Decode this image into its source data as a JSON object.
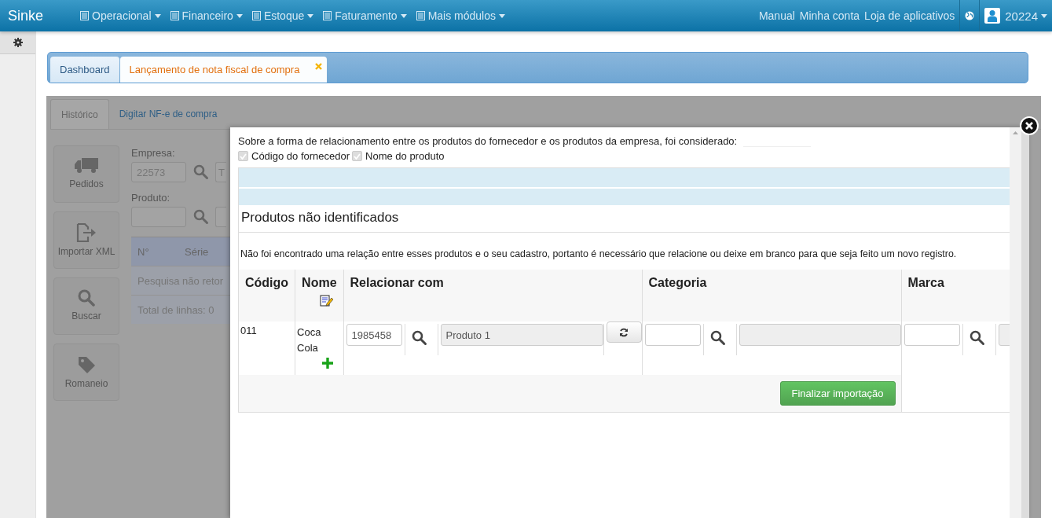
{
  "navbar": {
    "brand": "Sinke",
    "menus": [
      {
        "label": "Operacional"
      },
      {
        "label": "Financeiro"
      },
      {
        "label": "Estoque"
      },
      {
        "label": "Faturamento"
      },
      {
        "label": "Mais módulos"
      }
    ],
    "links": [
      "Manual",
      "Minha conta",
      "Loja de aplicativos"
    ],
    "user": "20224"
  },
  "tabs": [
    {
      "label": "Dashboard",
      "selected": false,
      "closable": false
    },
    {
      "label": "Lançamento de nota fiscal de compra",
      "selected": true,
      "closable": true
    }
  ],
  "page": {
    "subtabs": [
      {
        "label": "Histórico",
        "selected": true
      },
      {
        "label": "Digitar NF-e de compra",
        "selected": false
      }
    ],
    "actions": [
      {
        "label": "Pedidos",
        "kind": "orders"
      },
      {
        "label": "Importar XML",
        "kind": "import"
      },
      {
        "label": "Buscar",
        "kind": "search"
      },
      {
        "label": "Romaneio",
        "kind": "packing"
      }
    ],
    "fields": [
      {
        "label": "Empresa:",
        "value": "22573",
        "extra_value": "T"
      },
      {
        "label": "Produto:"
      }
    ],
    "table": {
      "columns": [
        "N°",
        "Série"
      ],
      "message": "Pesquisa não retor",
      "total": "Total de linhas: 0"
    }
  },
  "modal": {
    "intro": "Sobre a forma de relacionamento entre os produtos do fornecedor e os produtos da empresa, foi considerado:",
    "criteria": [
      {
        "label": "Código do fornecedor",
        "checked": true,
        "disabled": true
      },
      {
        "label": "Nome do produto",
        "checked": true,
        "disabled": true
      }
    ],
    "heading": "Produtos não identificados",
    "note": "Não foi encontrado uma relação entre esses produtos e o seu cadastro, portanto é necessário que relacione ou deixe em branco para que seja feito um novo registro.",
    "table": {
      "columns": [
        {
          "label": "Código",
          "kind": "text"
        },
        {
          "label": "Nome",
          "kind": "name"
        },
        {
          "label": "Relacionar com",
          "kind": "relation"
        },
        {
          "label": "Categoria",
          "kind": "lookup"
        },
        {
          "label": "Marca",
          "kind": "lookup"
        }
      ],
      "rows": [
        {
          "code": "011",
          "name": "Coca Cola",
          "relation_code": "1985458",
          "relation_name": "Produto 1"
        }
      ]
    },
    "button": "Finalizar importação"
  }
}
